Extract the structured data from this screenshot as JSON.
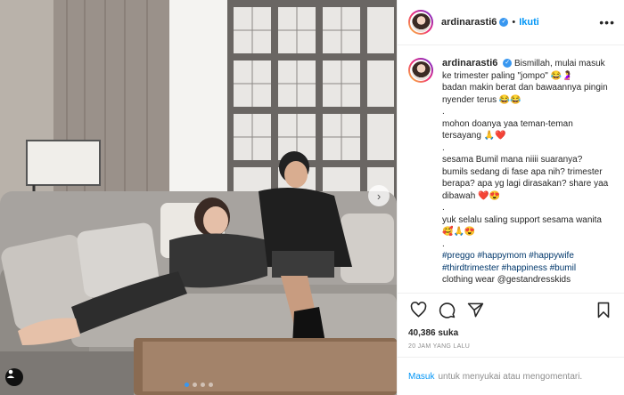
{
  "post": {
    "username": "ardinarasti6",
    "separator": "•",
    "follow_label": "Ikuti",
    "more_label": "•••",
    "caption_lines": [
      "Bismillah, mulai masuk ke trimester paling \"jompo\" 😂🤰",
      "badan makin berat dan bawaannya pingin nyender terus 😂😂",
      ".",
      "mohon doanya yaa teman-teman tersayang 🙏❤️",
      ".",
      "sesama Bumil mana niiii suaranya? bumils sedang di fase apa nih? trimester berapa? apa yg lagi dirasakan? share yaa dibawah ❤️😍",
      ".",
      "yuk selalu saling support sesama wanita 🥰🙏😍",
      "."
    ],
    "hashtags": "#preggo #happymom #happywife #thirdtrimester #happiness #bumil",
    "hashtags_cut": "clothing wear @gestandresskids",
    "likes": "40,386 suka",
    "time": "20 JAM YANG LALU",
    "login_link": "Masuk",
    "login_text": "untuk menyukai atau mengomentari."
  },
  "icons": {
    "like": "heart-icon",
    "comment": "comment-icon",
    "share": "share-icon",
    "save": "bookmark-icon",
    "user_tag": "user-tag-icon",
    "next": "chevron-right-icon",
    "verified": "verified-badge-icon"
  },
  "carousel": {
    "count": 4,
    "active": 1
  },
  "colors": {
    "accent": "#0095f6",
    "verified": "#3897f0",
    "link": "#00376b",
    "muted": "#8e8e8e"
  }
}
